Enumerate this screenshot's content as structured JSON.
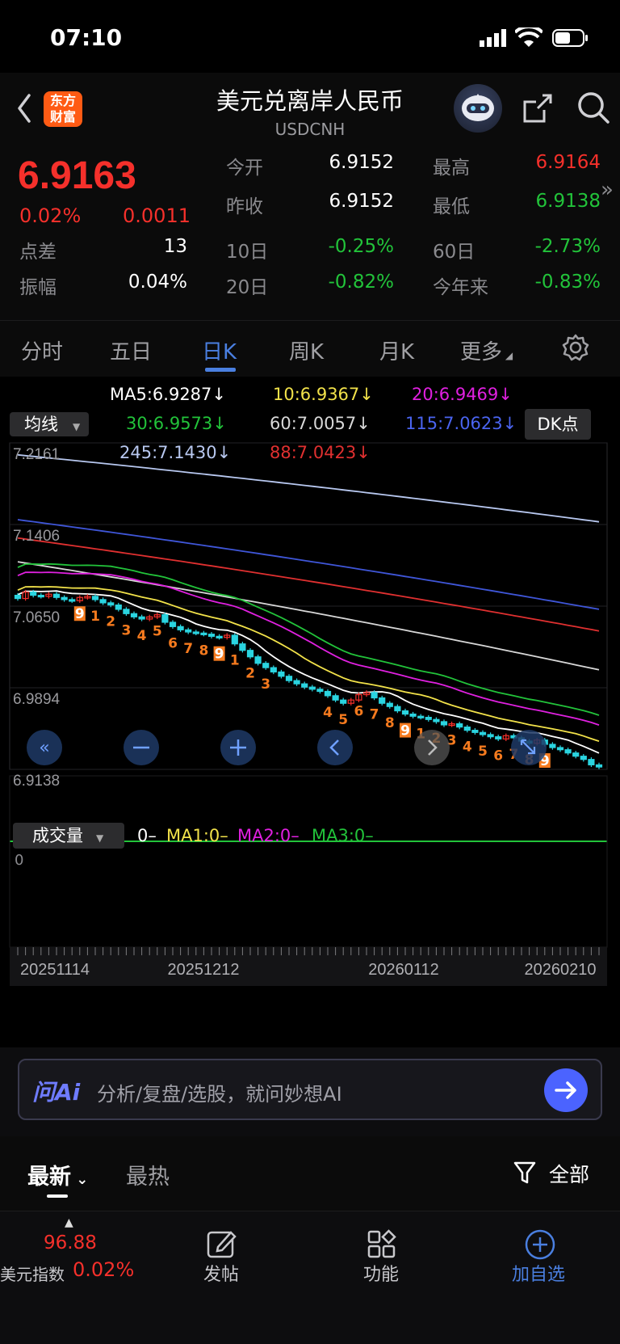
{
  "status": {
    "time": "07:10"
  },
  "header": {
    "logo_text_1": "东方",
    "logo_text_2": "财富",
    "title": "美元兑离岸人民币",
    "subtitle": "USDCNH"
  },
  "quote": {
    "price": "6.9163",
    "change_pct": "0.02%",
    "change": "0.0011",
    "open_label": "今开",
    "open": "6.9152",
    "high_label": "最高",
    "high": "6.9164",
    "prevclose_label": "昨收",
    "prevclose": "6.9152",
    "low_label": "最低",
    "low": "6.9138",
    "spread_label": "点差",
    "spread": "13",
    "d10_label": "10日",
    "d10": "-0.25%",
    "d60_label": "60日",
    "d60": "-2.73%",
    "amp_label": "振幅",
    "amp": "0.04%",
    "d20_label": "20日",
    "d20": "-0.82%",
    "ytd_label": "今年来",
    "ytd": "-0.83%"
  },
  "tabs": {
    "items": [
      "分时",
      "五日",
      "日K",
      "周K",
      "月K",
      "更多"
    ],
    "active": "日K"
  },
  "chart": {
    "ma_select": "均线",
    "dk_button": "DK点",
    "ma_labels": {
      "ma5": "MA5:6.9287↓",
      "ma10": "10:6.9367↓",
      "ma20": "20:6.9469↓",
      "ma30": "30:6.9573↓",
      "ma60": "60:7.0057↓",
      "ma115": "115:7.0623↓",
      "ma245": "245:7.1430↓",
      "ma88": "88:7.0423↓"
    },
    "colors": {
      "ma5": "#ffffff",
      "ma10": "#f2e24a",
      "ma20": "#e020e0",
      "ma30": "#22c33a",
      "ma60": "#d8d8d8",
      "ma115": "#3f56d8",
      "ma245": "#b8c8f0",
      "ma88": "#e03030",
      "up": "#f5302b",
      "down": "#2ad4e0"
    },
    "y_ticks": [
      "7.2161",
      "7.1406",
      "7.0650",
      "6.9894",
      "6.9138"
    ],
    "x_ticks": [
      "20251114",
      "20251212",
      "20260112",
      "20260210"
    ],
    "volume": {
      "select": "成交量",
      "label_v": "0–",
      "label_ma1": "MA1:0–",
      "label_ma2": "MA2:0–",
      "label_ma3": "MA3:0–",
      "axis_zero": "0"
    },
    "td_seq_1": [
      "9",
      "1",
      "2",
      "3",
      "4",
      "5",
      "6",
      "7",
      "8",
      "9",
      "1",
      "2",
      "3"
    ],
    "td_seq_2": [
      "4",
      "5",
      "6",
      "7",
      "8",
      "9",
      "1",
      "2",
      "3",
      "4",
      "5",
      "6",
      "7",
      "8",
      "9"
    ]
  },
  "chart_data": {
    "type": "candlestick",
    "ylim": [
      6.9138,
      7.2161
    ],
    "closes": [
      7.072,
      7.078,
      7.075,
      7.074,
      7.076,
      7.073,
      7.071,
      7.07,
      7.073,
      7.074,
      7.071,
      7.068,
      7.066,
      7.062,
      7.058,
      7.055,
      7.053,
      7.055,
      7.057,
      7.05,
      7.046,
      7.043,
      7.041,
      7.04,
      7.039,
      7.037,
      7.036,
      7.038,
      7.03,
      7.024,
      7.018,
      7.012,
      7.008,
      7.004,
      7.0,
      6.996,
      6.993,
      6.99,
      6.988,
      6.986,
      6.982,
      6.978,
      6.975,
      6.978,
      6.983,
      6.985,
      6.98,
      6.975,
      6.972,
      6.968,
      6.965,
      6.963,
      6.962,
      6.96,
      6.958,
      6.955,
      6.956,
      6.953,
      6.95,
      6.948,
      6.946,
      6.944,
      6.942,
      6.945,
      6.943,
      6.94,
      6.938,
      6.941,
      6.937,
      6.934,
      6.932,
      6.929,
      6.926,
      6.923,
      6.918,
      6.916
    ]
  },
  "ai": {
    "logo": "问Ai",
    "placeholder": "分析/复盘/选股，就问妙想AI"
  },
  "news": {
    "latest": "最新",
    "hot": "最热",
    "all": "全部"
  },
  "bottom": {
    "index_value": "96.88",
    "index_name": "美元指数",
    "index_pct": "0.02%",
    "post": "发帖",
    "functions": "功能",
    "add_watch": "加自选"
  }
}
